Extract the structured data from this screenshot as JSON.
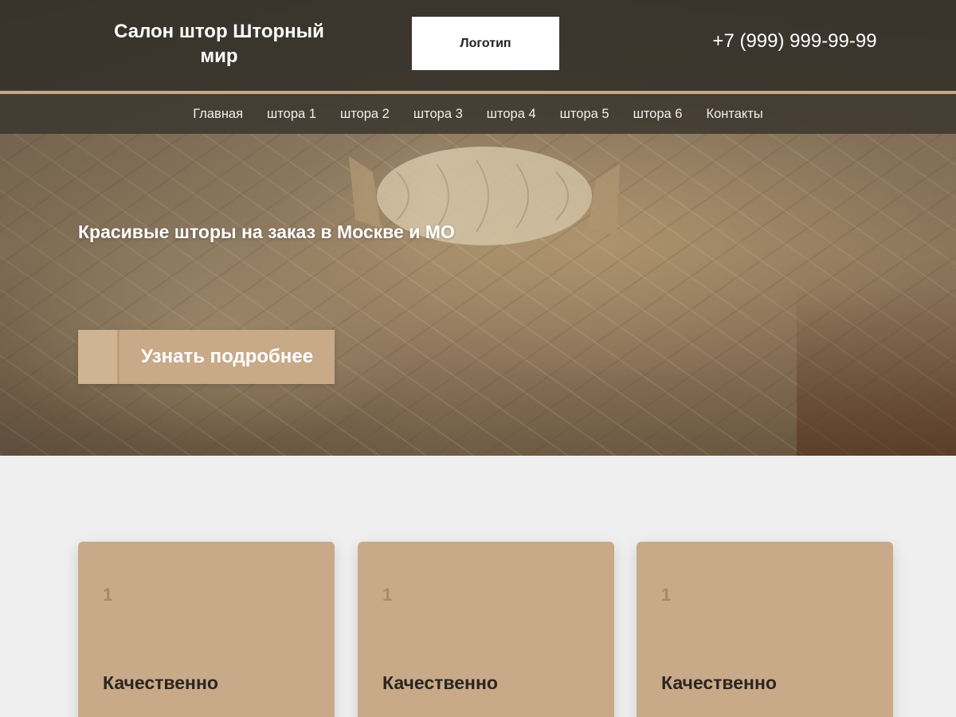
{
  "header": {
    "site_title": "Салон штор Шторный мир",
    "logo_label": "Логотип",
    "phone": "+7 (999) 999-99-99"
  },
  "nav": {
    "items": [
      "Главная",
      "штора 1",
      "штора 2",
      "штора 3",
      "штора 4",
      "штора 5",
      "штора 6",
      "Контакты"
    ]
  },
  "hero": {
    "heading": "Красивые шторы на заказ в Москве и МО",
    "cta_label": "Узнать подробнее"
  },
  "cards": [
    {
      "number": "1",
      "title": "Качественно"
    },
    {
      "number": "1",
      "title": "Качественно"
    },
    {
      "number": "1",
      "title": "Качественно"
    }
  ],
  "colors": {
    "accent": "#c8aa88",
    "header_bg": "#322e28",
    "page_bg": "#efefef"
  }
}
